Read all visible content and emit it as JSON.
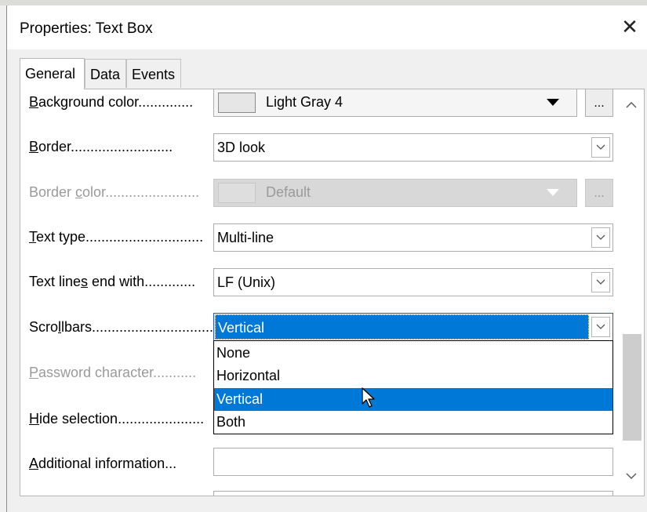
{
  "dialog": {
    "title": "Properties: Text Box",
    "close_glyph": "✕"
  },
  "tabs": [
    {
      "label": "General",
      "active": true
    },
    {
      "label": "Data",
      "active": false
    },
    {
      "label": "Events",
      "active": false
    }
  ],
  "rows": {
    "background_color": {
      "accel": "B",
      "rest": "ackground color",
      "dots": "..............",
      "value": "Light Gray 4",
      "swatch": "#e6e6e6",
      "more": "..."
    },
    "border": {
      "accel": "B",
      "rest": "order",
      "dots": "..........................",
      "value": "3D look"
    },
    "border_color": {
      "pre": "Border ",
      "accel": "c",
      "rest": "olor",
      "dots": "........................",
      "value": "Default",
      "more": "..."
    },
    "text_type": {
      "accel": "T",
      "rest": "ext type",
      "dots": "..............................",
      "value": "Multi-line"
    },
    "text_lines_end": {
      "pre": "Text line",
      "accel": "s",
      "rest": " end with",
      "dots": ".............",
      "value": "LF (Unix)"
    },
    "scrollbars": {
      "pre": "Scro",
      "accel": "l",
      "rest": "lbars",
      "dots": "...............................",
      "value": "Vertical"
    },
    "password_char": {
      "accel": "P",
      "rest": "assword character",
      "dots": "..........."
    },
    "hide_selection": {
      "accel": "H",
      "rest": "ide selection",
      "dots": "......................"
    },
    "additional_info": {
      "accel": "A",
      "rest": "dditional information",
      "dots": "...",
      "value": ""
    }
  },
  "scrollbars_dropdown": {
    "options": [
      "None",
      "Horizontal",
      "Vertical",
      "Both"
    ],
    "selected_index": 2
  },
  "colors": {
    "selection": "#0078d7",
    "disabled_text": "#9a9a9a"
  },
  "icons": {
    "dropdown": "chevron-down-icon",
    "scroll_up": "chevron-up-icon",
    "scroll_down": "chevron-down-icon",
    "pointer": "mouse-pointer-icon"
  }
}
